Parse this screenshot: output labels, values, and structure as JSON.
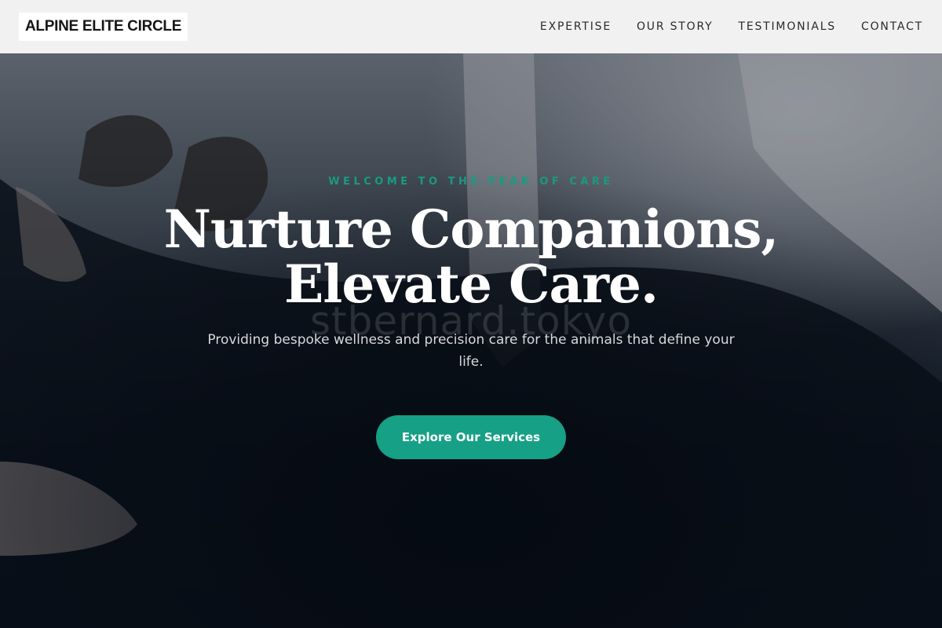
{
  "header": {
    "logo": "ALPINE ELITE CIRCLE",
    "nav": [
      {
        "label": "EXPERTISE"
      },
      {
        "label": "OUR STORY"
      },
      {
        "label": "TESTIMONIALS"
      },
      {
        "label": "CONTACT"
      }
    ]
  },
  "hero": {
    "eyebrow": "WELCOME TO THE PEAK OF CARE",
    "headline_line1": "Nurture Companions,",
    "headline_line2": "Elevate Care.",
    "subtitle": "Providing bespoke wellness and precision care for the animals that define your life.",
    "cta_label": "Explore Our Services",
    "watermark": "stbernard.tokyo"
  },
  "colors": {
    "accent": "#16a085",
    "header_bg": "#f1f1f1",
    "hero_dark": "#0d1520"
  }
}
